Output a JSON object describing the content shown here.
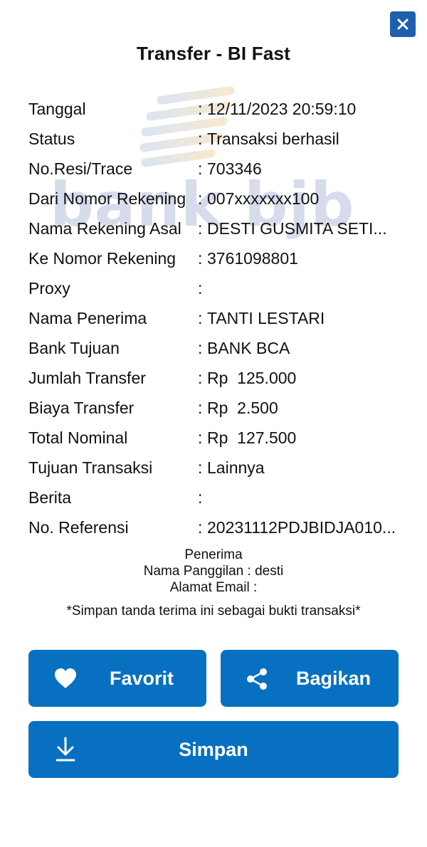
{
  "header": {
    "title": "Transfer - BI Fast",
    "watermark_text": "bank bjb"
  },
  "details": [
    {
      "label": "Tanggal",
      "value": "12/11/2023 20:59:10"
    },
    {
      "label": "Status",
      "value": "Transaksi berhasil"
    },
    {
      "label": "No.Resi/Trace",
      "value": "703346"
    },
    {
      "label": "Dari Nomor Rekening",
      "value": "007xxxxxxx100"
    },
    {
      "label": "Nama Rekening Asal",
      "value": "DESTI GUSMITA SETI..."
    },
    {
      "label": "Ke Nomor Rekening",
      "value": "3761098801"
    },
    {
      "label": "Proxy",
      "value": ""
    },
    {
      "label": "Nama Penerima",
      "value": "TANTI LESTARI"
    },
    {
      "label": "Bank Tujuan",
      "value": "BANK BCA"
    },
    {
      "label": "Jumlah Transfer",
      "value": "Rp  125.000"
    },
    {
      "label": "Biaya Transfer",
      "value": "Rp  2.500"
    },
    {
      "label": "Total Nominal",
      "value": "Rp  127.500"
    },
    {
      "label": "Tujuan Transaksi",
      "value": "Lainnya"
    },
    {
      "label": "Berita",
      "value": ""
    },
    {
      "label": "No. Referensi",
      "value": "20231112PDJBIDJA010..."
    }
  ],
  "receiver": {
    "heading": "Penerima",
    "nickname_line": "Nama Panggilan : desti",
    "email_line": "Alamat Email :"
  },
  "note": "*Simpan tanda terima ini sebagai bukti transaksi*",
  "buttons": {
    "favorite_label": "Favorit",
    "share_label": "Bagikan",
    "save_label": "Simpan"
  },
  "icons": {
    "close": "close-icon",
    "favorite": "heart-icon",
    "share": "share-icon",
    "save": "download-icon"
  },
  "colors": {
    "primary": "#0870c0",
    "close_button": "#1e5fae",
    "text": "#111111",
    "background": "#ffffff"
  }
}
